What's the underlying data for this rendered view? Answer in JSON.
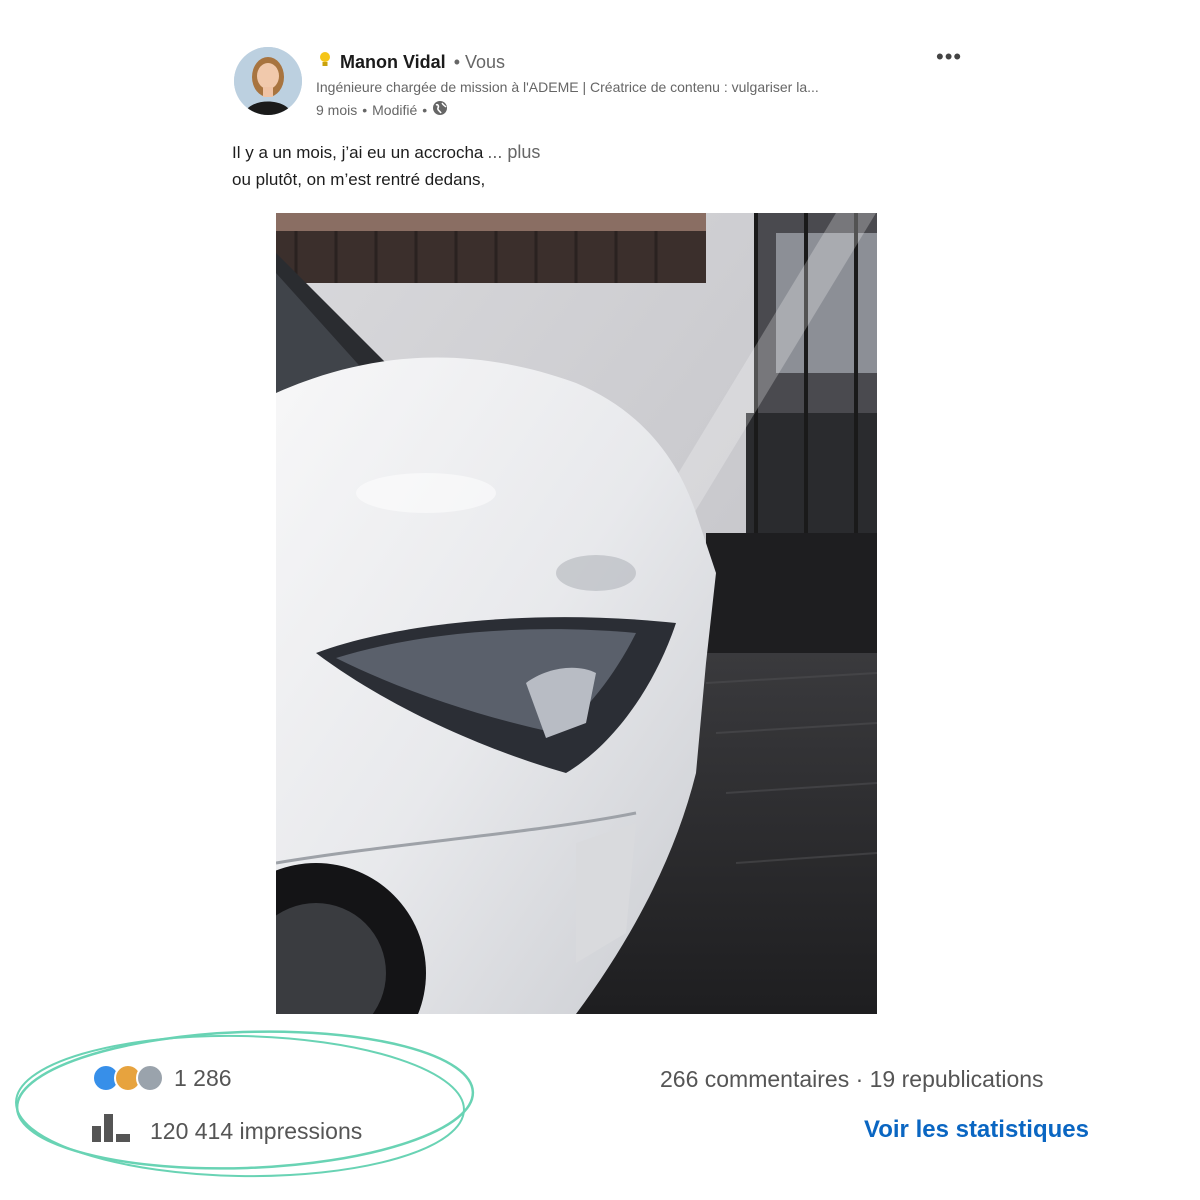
{
  "post": {
    "author": {
      "name": "Manon Vidal",
      "relation": "• Vous",
      "headline": "Ingénieure chargée de mission à l'ADEME | Créatrice de contenu : vulgariser la...",
      "time": "9 mois",
      "edited": "Modifié",
      "separator": "•",
      "icons": {
        "badge": "lightbulb-icon",
        "visibility": "globe-icon"
      }
    },
    "menu_icon": "more-options-icon",
    "text_line1": "Il y a un mois, j’ai eu un accrocha",
    "see_more": "... plus",
    "text_line2": "ou plutôt, on m’est rentré dedans,"
  },
  "stats": {
    "reactions_count": "1 286",
    "impressions": "120 414 impressions",
    "comments_reposts": "266 commentaires · 19 republications",
    "view_stats": "Voir les statistiques",
    "colors": {
      "link": "#0a66c2",
      "highlight_ellipse": "#69d3b4"
    }
  }
}
